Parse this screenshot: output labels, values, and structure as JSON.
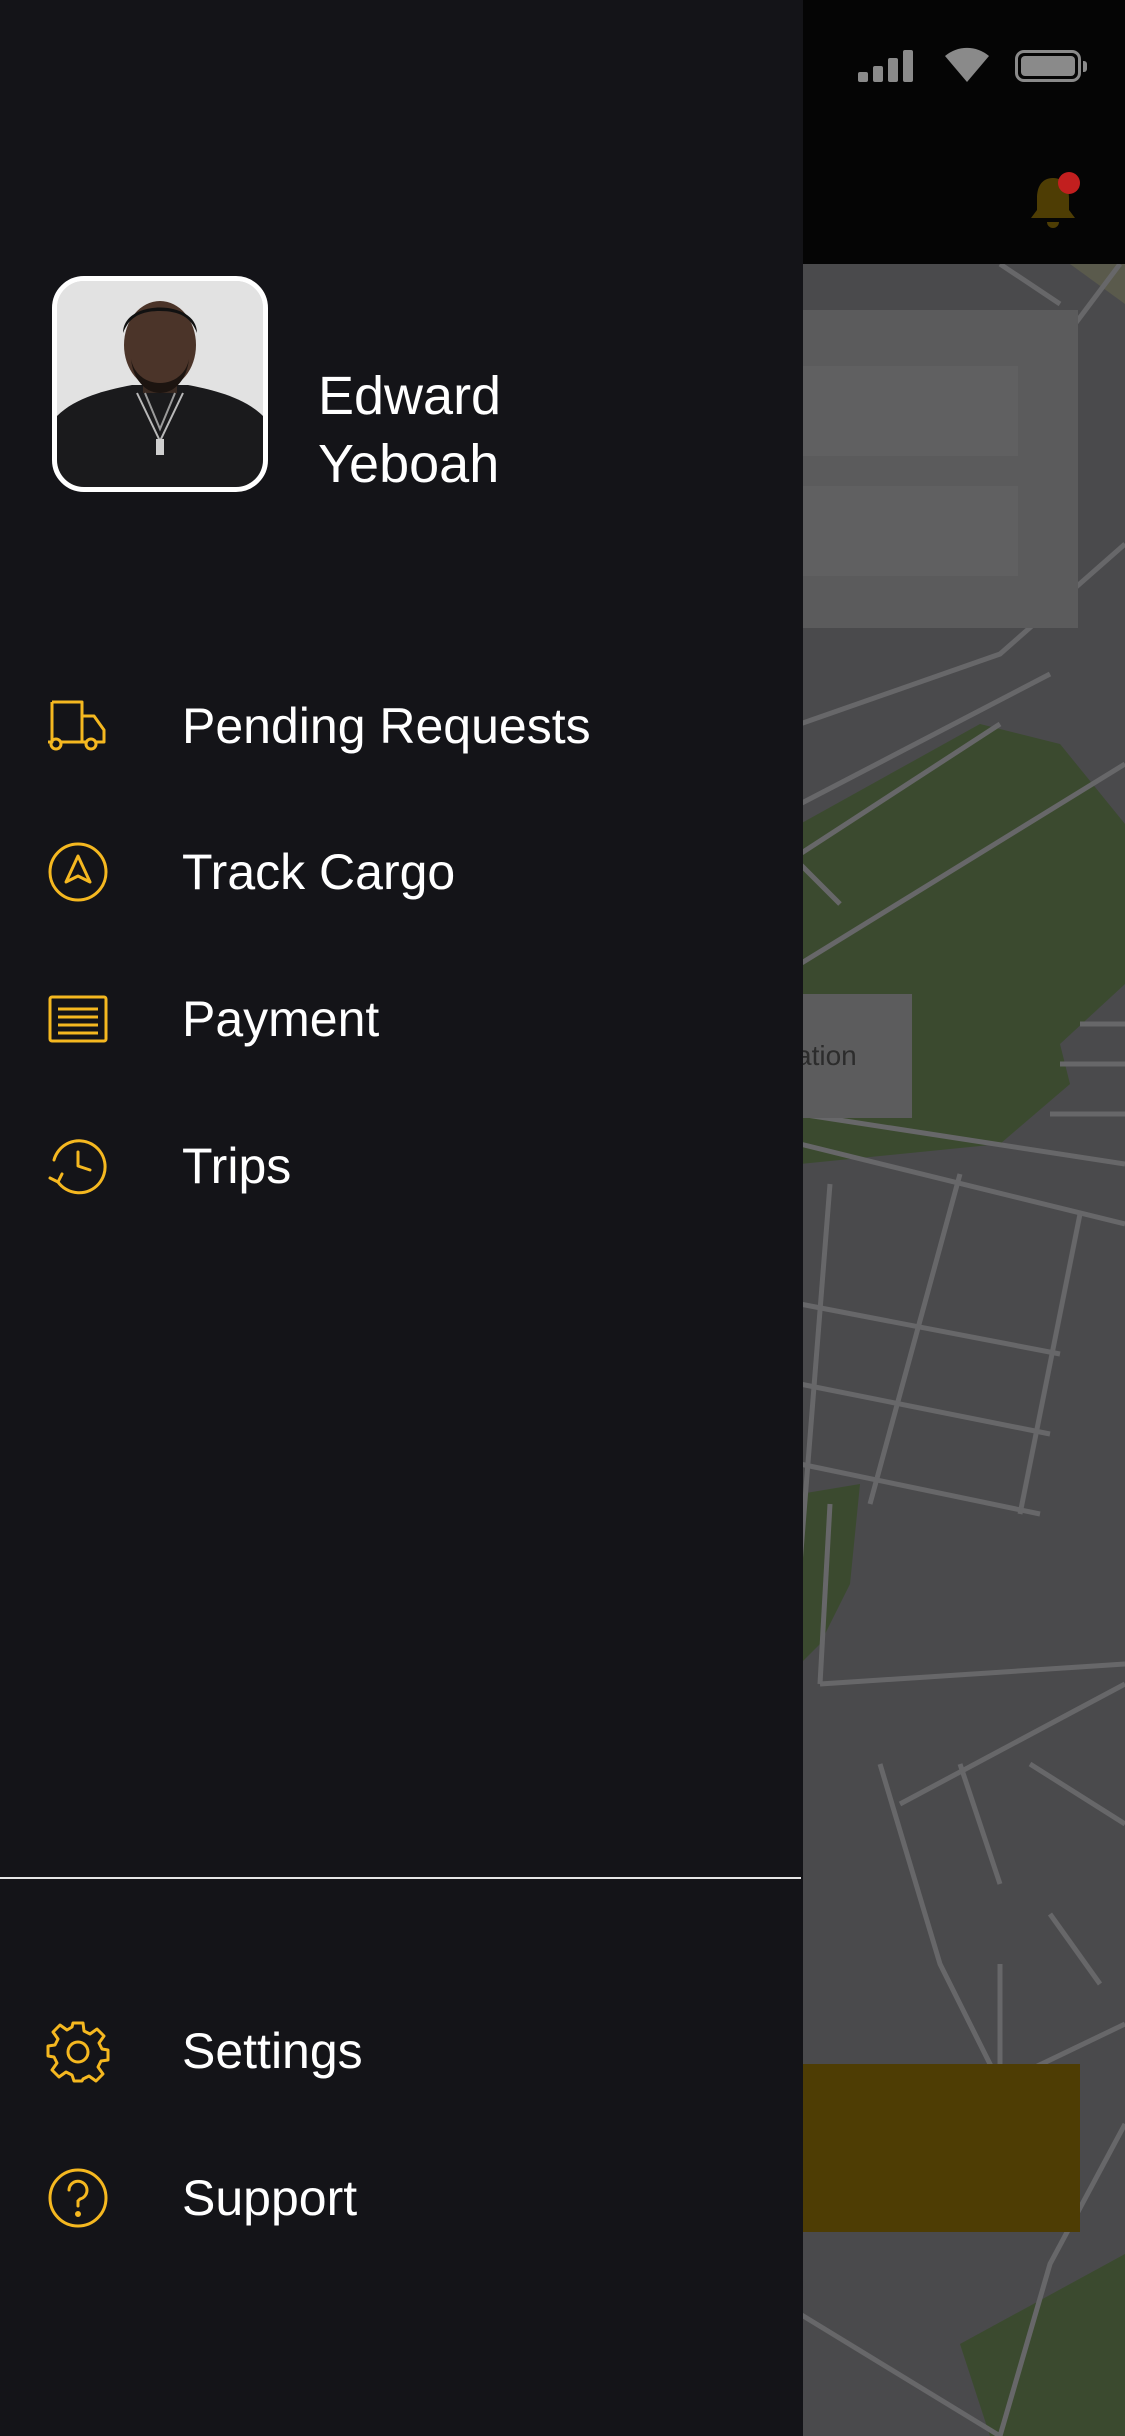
{
  "user": {
    "name_line1": "Edward",
    "name_line2": "Yeboah"
  },
  "menu": {
    "items": [
      {
        "label": "Pending Requests",
        "icon": "truck-icon"
      },
      {
        "label": "Track Cargo",
        "icon": "navigation-icon"
      },
      {
        "label": "Payment",
        "icon": "list-icon"
      },
      {
        "label": "Trips",
        "icon": "history-icon"
      }
    ],
    "footer_items": [
      {
        "label": "Settings",
        "icon": "gear-icon"
      },
      {
        "label": "Support",
        "icon": "help-icon"
      }
    ]
  },
  "background": {
    "location_chip_text": "cation"
  },
  "colors": {
    "accent": "#F5B820",
    "drawer_bg": "#141418",
    "map_bg": "#4A4A4C",
    "park": "#3B4A2F",
    "notification": "#C21F1F"
  }
}
